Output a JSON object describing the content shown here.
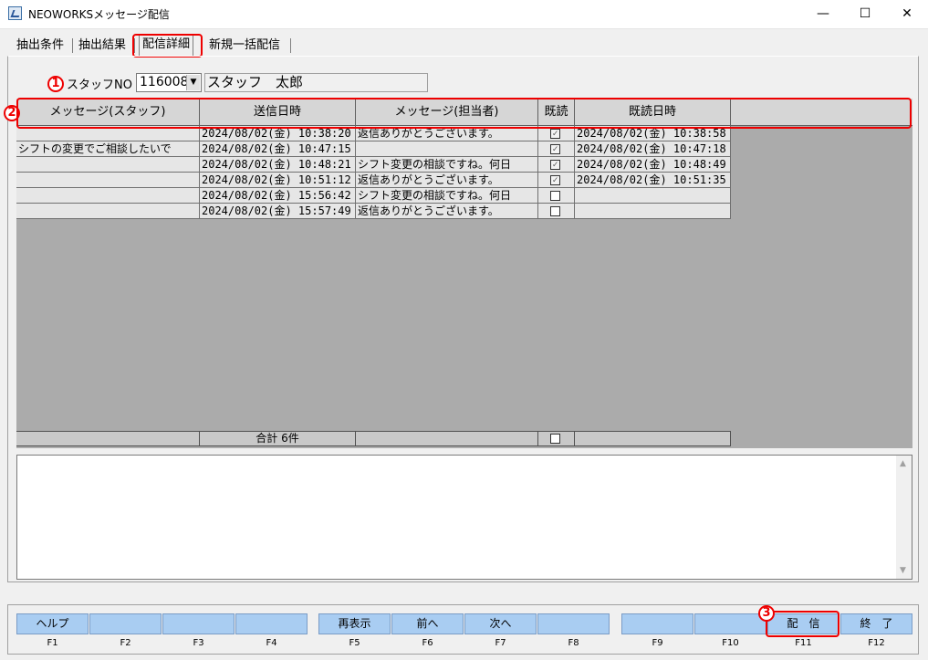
{
  "window": {
    "title": "NEOWORKSメッセージ配信",
    "minimize": "—",
    "maximize": "☐",
    "close": "✕"
  },
  "tabs": [
    {
      "label": "抽出条件"
    },
    {
      "label": "抽出結果"
    },
    {
      "label": "配信詳細",
      "selected": true
    },
    {
      "label": "新規一括配信"
    }
  ],
  "callouts": [
    "1",
    "2",
    "3"
  ],
  "staff": {
    "label": "スタッフNO",
    "number": "116008",
    "name": "スタッフ　太郎"
  },
  "grid": {
    "headers": [
      "メッセージ(スタッフ)",
      "送信日時",
      "メッセージ(担当者)",
      "既読",
      "既読日時"
    ],
    "rows": [
      {
        "staff_msg": "",
        "sent": "2024/08/02(金) 10:38:20",
        "admin_msg": "返信ありがとうございます。",
        "read": true,
        "read_at": "2024/08/02(金) 10:38:58"
      },
      {
        "staff_msg": "シフトの変更でご相談したいで",
        "sent": "2024/08/02(金) 10:47:15",
        "admin_msg": "",
        "read": true,
        "read_at": "2024/08/02(金) 10:47:18"
      },
      {
        "staff_msg": "",
        "sent": "2024/08/02(金) 10:48:21",
        "admin_msg": "シフト変更の相談ですね。何日",
        "read": true,
        "read_at": "2024/08/02(金) 10:48:49"
      },
      {
        "staff_msg": "",
        "sent": "2024/08/02(金) 10:51:12",
        "admin_msg": "返信ありがとうございます。",
        "read": true,
        "read_at": "2024/08/02(金) 10:51:35"
      },
      {
        "staff_msg": "",
        "sent": "2024/08/02(金) 15:56:42",
        "admin_msg": "シフト変更の相談ですね。何日",
        "read": false,
        "read_at": ""
      },
      {
        "staff_msg": "",
        "sent": "2024/08/02(金) 15:57:49",
        "admin_msg": "返信ありがとうございます。",
        "read": false,
        "read_at": ""
      }
    ],
    "total": "合計 6件"
  },
  "function_keys": [
    {
      "label": "ヘルプ",
      "key": "F1"
    },
    {
      "label": "",
      "key": "F2"
    },
    {
      "label": "",
      "key": "F3"
    },
    {
      "label": "",
      "key": "F4"
    },
    {
      "label": "再表示",
      "key": "F5"
    },
    {
      "label": "前へ",
      "key": "F6"
    },
    {
      "label": "次へ",
      "key": "F7"
    },
    {
      "label": "",
      "key": "F8"
    },
    {
      "label": "",
      "key": "F9"
    },
    {
      "label": "",
      "key": "F10"
    },
    {
      "label": "配　信",
      "key": "F11"
    },
    {
      "label": "終　了",
      "key": "F12"
    }
  ],
  "icons": {
    "combo_arrow": "chevron-down-icon",
    "scroll_up": "scroll-up-icon",
    "scroll_down": "scroll-down-icon",
    "check": "check-icon"
  },
  "colors": {
    "fkey": "#a9cdf2",
    "callout": "#ee0000",
    "grid_bg": "#ababab"
  }
}
